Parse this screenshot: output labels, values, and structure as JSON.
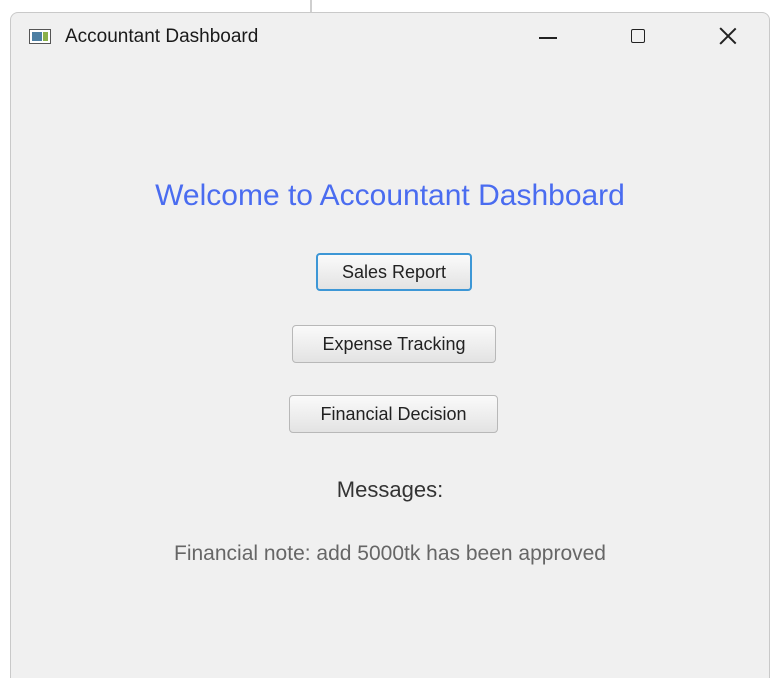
{
  "window": {
    "title": "Accountant Dashboard",
    "icon": "app-window-icon",
    "controls": [
      "minimize-icon",
      "maximize-icon",
      "close-icon"
    ]
  },
  "main": {
    "heading": "Welcome to Accountant Dashboard",
    "heading_color": "#4a6cf0",
    "buttons": {
      "sales_report": "Sales Report",
      "expense_tracking": "Expense Tracking",
      "financial_decision": "Financial Decision"
    },
    "messages_label": "Messages:",
    "message_text": "Financial note: add 5000tk has been approved"
  }
}
